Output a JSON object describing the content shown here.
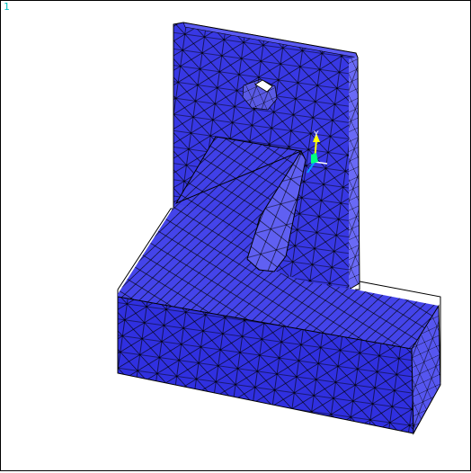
{
  "window": {
    "number": "1"
  },
  "triad": {
    "y_label": "Y",
    "x_label": "X"
  },
  "colors": {
    "background": "#ffffff",
    "mesh_fill_front": "#3a3ae6",
    "mesh_fill_side": "#5a5af2",
    "mesh_fill_top": "#4848ec",
    "mesh_lines": "#000000",
    "window_number": "#00bfbf",
    "triad_y": "#ffff00",
    "triad_x": "#00a0ff",
    "triad_z": "#00ff80"
  }
}
